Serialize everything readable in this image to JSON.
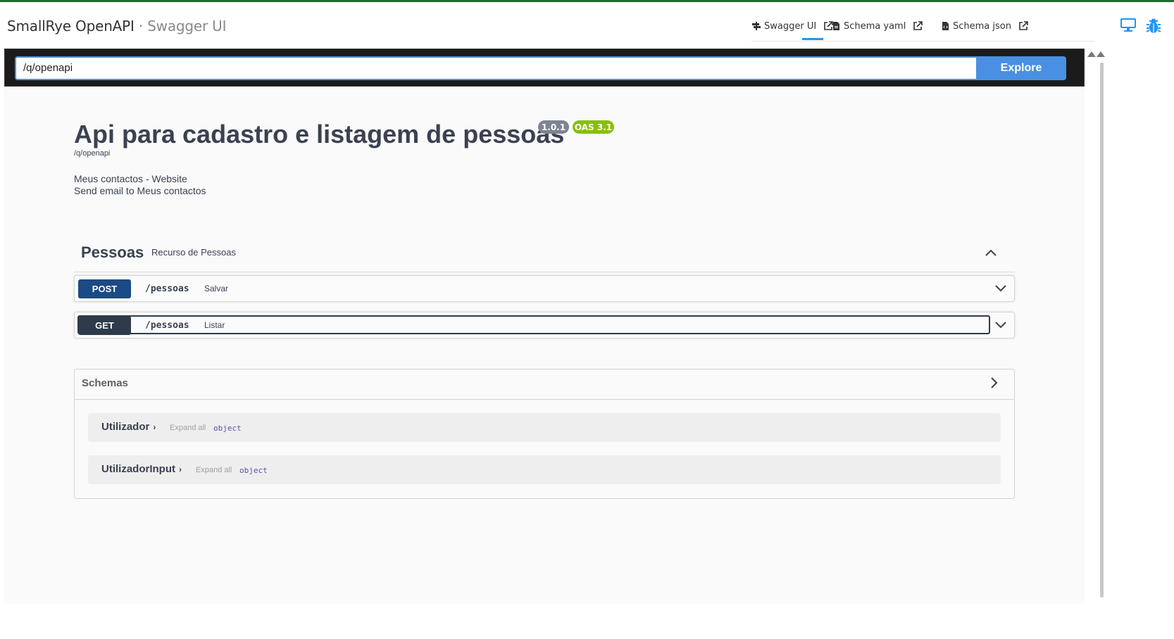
{
  "header": {
    "brand_main": "SmallRye OpenAPI",
    "brand_sub": " · Swagger UI",
    "tabs": [
      {
        "label": "Swagger UI",
        "icon": "signpost-icon"
      },
      {
        "label": "Schema yaml",
        "icon": "file-icon"
      },
      {
        "label": "Schema json",
        "icon": "file-code-icon"
      }
    ],
    "right_icons": [
      "monitor-icon",
      "bug-icon"
    ],
    "accent": "#2196f3"
  },
  "topbar": {
    "url_value": "/q/openapi",
    "explore_label": "Explore"
  },
  "info": {
    "title": "Api para cadastro e listagem de pessoas",
    "version": "1.0.1",
    "oas": "OAS 3.1",
    "url": "/q/openapi",
    "contact_website": "Meus contactos - Website",
    "contact_email": "Send email to Meus contactos"
  },
  "tag": {
    "name": "Pessoas",
    "description": "Recurso de Pessoas"
  },
  "operations": [
    {
      "method": "POST",
      "path": "/pessoas",
      "summary": "Salvar"
    },
    {
      "method": "GET",
      "path": "/pessoas",
      "summary": "Listar"
    }
  ],
  "schemas": {
    "title": "Schemas",
    "models": [
      {
        "name": "Utilizador",
        "expand": "Expand all",
        "type": "object"
      },
      {
        "name": "UtilizadorInput",
        "expand": "Expand all",
        "type": "object"
      }
    ]
  },
  "colors": {
    "post": "#1c4a85",
    "get": "#2e3b4a",
    "version_badge": "#7d8492",
    "oas_badge": "#89bf04",
    "explore": "#4990e2"
  }
}
